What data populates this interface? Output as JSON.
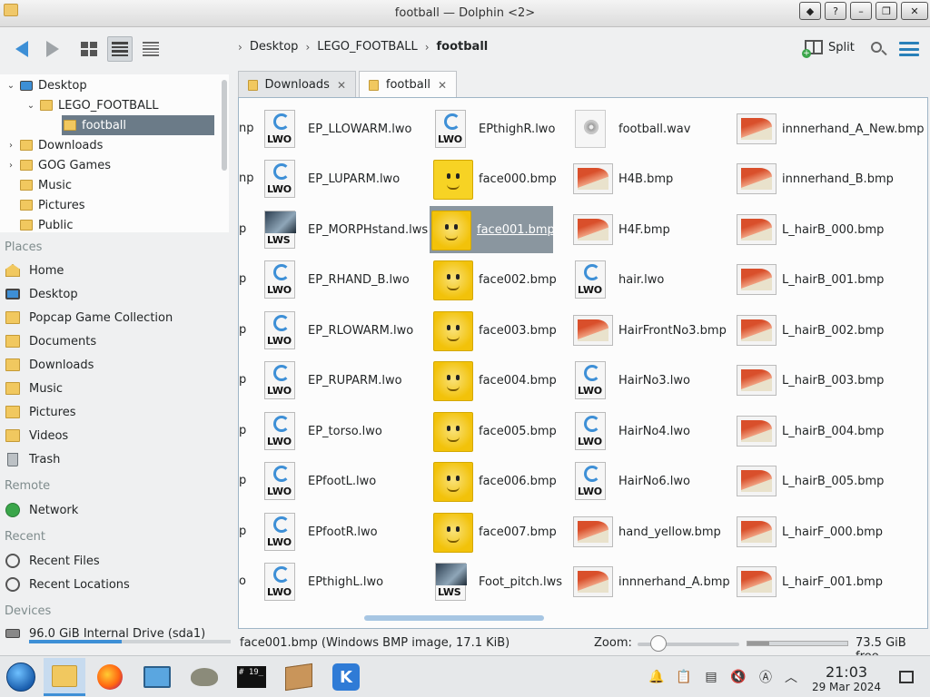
{
  "window": {
    "title": "football — Dolphin <2>"
  },
  "toolbar": {
    "breadcrumb": [
      "Desktop",
      "LEGO_FOOTBALL",
      "football"
    ],
    "split_label": "Split"
  },
  "tree": {
    "items": [
      {
        "label": "Desktop",
        "arrow": "⌄"
      },
      {
        "label": "LEGO_FOOTBALL",
        "arrow": "⌄"
      },
      {
        "label": "football",
        "arrow": ""
      },
      {
        "label": "Downloads",
        "arrow": "›"
      },
      {
        "label": "GOG Games",
        "arrow": "›"
      },
      {
        "label": "Music",
        "arrow": ""
      },
      {
        "label": "Pictures",
        "arrow": ""
      },
      {
        "label": "Public",
        "arrow": ""
      }
    ]
  },
  "places": {
    "header": "Places",
    "items": [
      {
        "label": "Home",
        "icon": "home-icon"
      },
      {
        "label": "Desktop",
        "icon": "desktop-icon"
      },
      {
        "label": "Popcap Game Collection",
        "icon": "folder-icon"
      },
      {
        "label": "Documents",
        "icon": "folder-icon"
      },
      {
        "label": "Downloads",
        "icon": "folder-icon"
      },
      {
        "label": "Music",
        "icon": "folder-icon"
      },
      {
        "label": "Pictures",
        "icon": "folder-icon"
      },
      {
        "label": "Videos",
        "icon": "folder-icon"
      },
      {
        "label": "Trash",
        "icon": "trash-icon"
      }
    ]
  },
  "remote": {
    "header": "Remote",
    "items": [
      {
        "label": "Network",
        "icon": "network-icon"
      }
    ]
  },
  "recent": {
    "header": "Recent",
    "items": [
      {
        "label": "Recent Files",
        "icon": "recent-files-icon"
      },
      {
        "label": "Recent Locations",
        "icon": "recent-locations-icon"
      }
    ]
  },
  "devices": {
    "header": "Devices",
    "items": [
      {
        "label": "96.0 GiB Internal Drive (sda1)",
        "icon": "drive-icon"
      }
    ]
  },
  "tabs": [
    {
      "label": "Downloads",
      "active": false
    },
    {
      "label": "football",
      "active": true
    }
  ],
  "files": {
    "cut_column": [
      "np",
      "np",
      "p",
      "p",
      "p",
      "p",
      "p",
      "p",
      "p",
      "o"
    ],
    "columns": [
      [
        {
          "name": "EP_LLOWARM.lwo",
          "kind": "lwo"
        },
        {
          "name": "EP_LUPARM.lwo",
          "kind": "lwo"
        },
        {
          "name": "EP_MORPHstand.lws",
          "kind": "lws"
        },
        {
          "name": "EP_RHAND_B.lwo",
          "kind": "lwo"
        },
        {
          "name": "EP_RLOWARM.lwo",
          "kind": "lwo"
        },
        {
          "name": "EP_RUPARM.lwo",
          "kind": "lwo"
        },
        {
          "name": "EP_torso.lwo",
          "kind": "lwo"
        },
        {
          "name": "EPfootL.lwo",
          "kind": "lwo"
        },
        {
          "name": "EPfootR.lwo",
          "kind": "lwo"
        },
        {
          "name": "EPthighL.lwo",
          "kind": "lwo"
        }
      ],
      [
        {
          "name": "EPthighR.lwo",
          "kind": "lwo"
        },
        {
          "name": "face000.bmp",
          "kind": "face-simple"
        },
        {
          "name": "face001.bmp",
          "kind": "face",
          "selected": true
        },
        {
          "name": "face002.bmp",
          "kind": "face"
        },
        {
          "name": "face003.bmp",
          "kind": "face"
        },
        {
          "name": "face004.bmp",
          "kind": "face"
        },
        {
          "name": "face005.bmp",
          "kind": "face"
        },
        {
          "name": "face006.bmp",
          "kind": "face"
        },
        {
          "name": "face007.bmp",
          "kind": "face"
        },
        {
          "name": "Foot_pitch.lws",
          "kind": "lws"
        }
      ],
      [
        {
          "name": "football.wav",
          "kind": "wav"
        },
        {
          "name": "H4B.bmp",
          "kind": "img"
        },
        {
          "name": "H4F.bmp",
          "kind": "img"
        },
        {
          "name": "hair.lwo",
          "kind": "lwo"
        },
        {
          "name": "HairFrontNo3.bmp",
          "kind": "img"
        },
        {
          "name": "HairNo3.lwo",
          "kind": "lwo"
        },
        {
          "name": "HairNo4.lwo",
          "kind": "lwo"
        },
        {
          "name": "HairNo6.lwo",
          "kind": "lwo"
        },
        {
          "name": "hand_yellow.bmp",
          "kind": "img"
        },
        {
          "name": "innnerhand_A.bmp",
          "kind": "img"
        }
      ],
      [
        {
          "name": "innnerhand_A_New.bmp",
          "kind": "img"
        },
        {
          "name": "innnerhand_B.bmp",
          "kind": "img"
        },
        {
          "name": "L_hairB_000.bmp",
          "kind": "img"
        },
        {
          "name": "L_hairB_001.bmp",
          "kind": "img"
        },
        {
          "name": "L_hairB_002.bmp",
          "kind": "img"
        },
        {
          "name": "L_hairB_003.bmp",
          "kind": "img"
        },
        {
          "name": "L_hairB_004.bmp",
          "kind": "img"
        },
        {
          "name": "L_hairB_005.bmp",
          "kind": "img"
        },
        {
          "name": "L_hairF_000.bmp",
          "kind": "img"
        },
        {
          "name": "L_hairF_001.bmp",
          "kind": "img"
        }
      ]
    ],
    "type_tags": {
      "lwo": "LWO",
      "lws": "LWS"
    }
  },
  "status": {
    "selection": "face001.bmp (Windows BMP image, 17.1 KiB)",
    "zoom_label": "Zoom:",
    "free_space": "73.5 GiB free"
  },
  "taskbar": {
    "apps": [
      "start-menu",
      "file-manager",
      "firefox",
      "system-monitor",
      "gimp",
      "terminal",
      "archive-manager",
      "kde-settings"
    ],
    "terminal_text": "# 19_",
    "kde_text": "K",
    "time": "21:03",
    "date": "29 Mar 2024"
  },
  "colors": {
    "accent": "#3d8fd6",
    "selection": "#6b7b88",
    "folder": "#f1c85f"
  }
}
